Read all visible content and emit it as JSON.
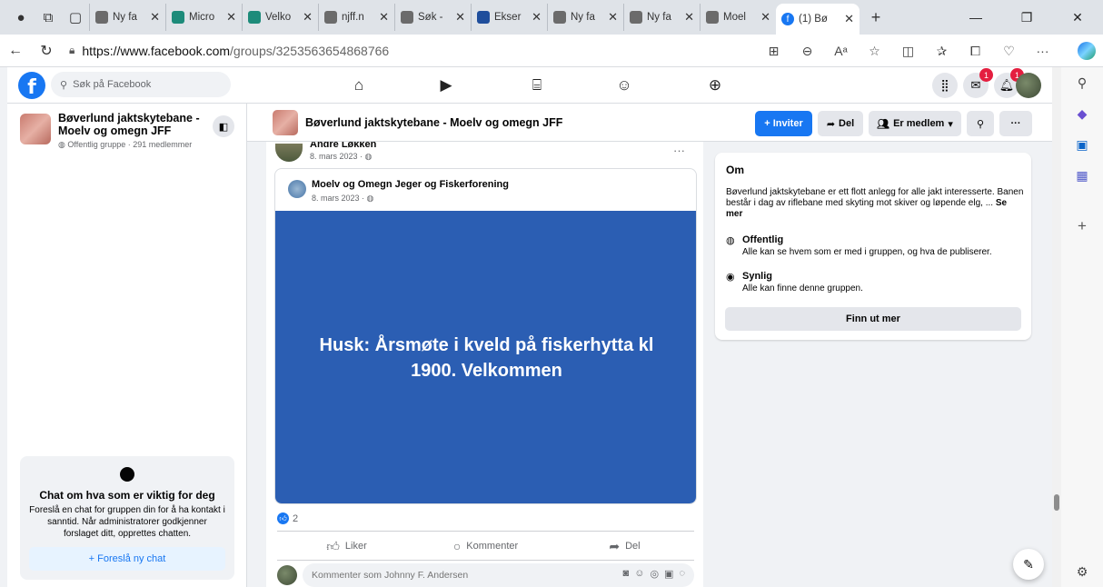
{
  "browser": {
    "tabs": [
      {
        "label": "Ny fa",
        "color": "#6b6b6b"
      },
      {
        "label": "Micro",
        "color": "#1d8b7a"
      },
      {
        "label": "Velko",
        "color": "#1d8b7a"
      },
      {
        "label": "njff.n",
        "color": "#6b6b6b"
      },
      {
        "label": "Søk -",
        "color": "#6b6b6b"
      },
      {
        "label": "Ekser",
        "color": "#1f4e9c"
      },
      {
        "label": "Ny fa",
        "color": "#6b6b6b"
      },
      {
        "label": "Ny fa",
        "color": "#6b6b6b"
      },
      {
        "label": "Moel",
        "color": "#6b6b6b"
      }
    ],
    "active_tab": "(1) Bø",
    "url_host": "https://www.facebook.com",
    "url_path": "/groups/3253563654868766"
  },
  "fb": {
    "search_placeholder": "Søk på Facebook",
    "messenger_badge": "1",
    "notif_badge": "1"
  },
  "sidebar": {
    "group_name": "Bøverlund jaktskytebane - Moelv og omegn JFF",
    "group_meta": "Offentlig gruppe · 291 medlemmer",
    "chat_title": "Chat om hva som er viktig for deg",
    "chat_desc": "Foreslå en chat for gruppen din for å ha kontakt i sanntid. Når administratorer godkjenner forslaget ditt, opprettes chatten.",
    "chat_button": "+ Foreslå ny chat"
  },
  "header": {
    "title": "Bøverlund jaktskytebane - Moelv og omegn JFF",
    "invite": "+ Inviter",
    "share": "Del",
    "member": "Er medlem"
  },
  "post": {
    "author": "André Løkken",
    "date": "8. mars 2023 ·",
    "shared_author": "Moelv og Omegn Jeger og Fiskerforening",
    "shared_date": "8. mars 2023 ·",
    "image_text": "Husk: Årsmøte i kveld på fiskerhytta kl 1900. Velkommen",
    "reactions": "2",
    "like": "Liker",
    "comment": "Kommenter",
    "share": "Del",
    "comment_placeholder": "Kommenter som Johnny F. Andersen"
  },
  "about": {
    "heading": "Om",
    "description": "Bøverlund jaktskytebane er ett flott anlegg for alle jakt interesserte. Banen består i dag av riflebane med skyting mot skiver og løpende elg, ...",
    "see_more": "Se mer",
    "public_label": "Offentlig",
    "public_desc": "Alle kan se hvem som er med i gruppen, og hva de publiserer.",
    "visible_label": "Synlig",
    "visible_desc": "Alle kan finne denne gruppen.",
    "button": "Finn ut mer"
  }
}
